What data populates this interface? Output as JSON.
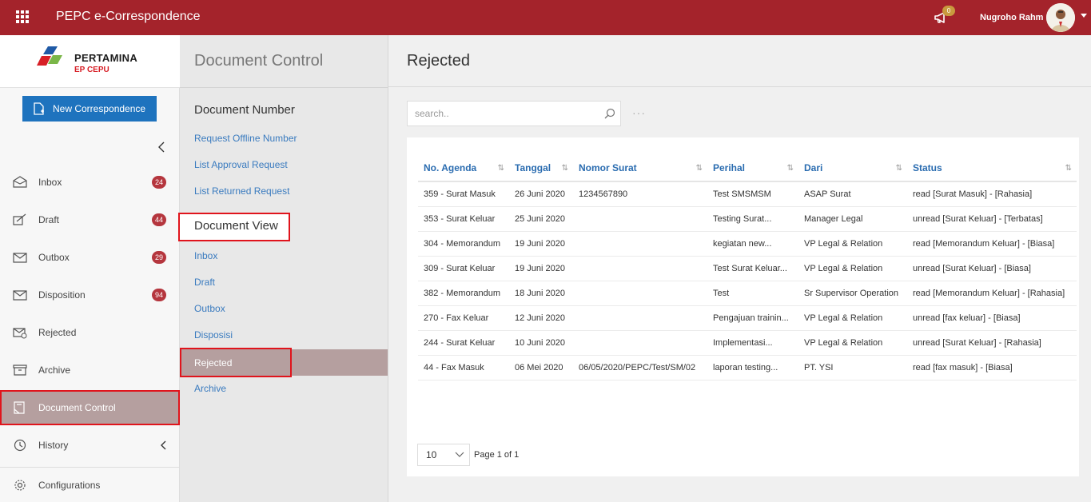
{
  "app": {
    "title": "PEPC e-Correspondence",
    "notification_count": "0",
    "user_name": "Nugroho Rahm"
  },
  "logo": {
    "line1": "PERTAMINA",
    "line2": "EP CEPU"
  },
  "sidebar": {
    "new_button": "New Correspondence",
    "items": [
      {
        "label": "Inbox",
        "badge": "24",
        "icon": "inbox-icon"
      },
      {
        "label": "Draft",
        "badge": "44",
        "icon": "draft-icon"
      },
      {
        "label": "Outbox",
        "badge": "29",
        "icon": "outbox-icon"
      },
      {
        "label": "Disposition",
        "badge": "94",
        "icon": "disposition-icon"
      },
      {
        "label": "Rejected",
        "badge": "",
        "icon": "rejected-icon"
      },
      {
        "label": "Archive",
        "badge": "",
        "icon": "archive-icon"
      },
      {
        "label": "Document Control",
        "badge": "",
        "icon": "document-control-icon"
      },
      {
        "label": "History",
        "badge": "",
        "icon": "history-icon"
      }
    ],
    "configurations": "Configurations"
  },
  "midpanel": {
    "title": "Document Control",
    "section1": "Document Number",
    "section1_links": [
      "Request Offline Number",
      "List Approval Request",
      "List Returned Request"
    ],
    "section2": "Document View",
    "section2_links": [
      "Inbox",
      "Draft",
      "Outbox",
      "Disposisi",
      "Rejected",
      "Archive"
    ]
  },
  "main": {
    "title": "Rejected",
    "search_placeholder": "search..",
    "more": "···",
    "columns": [
      "No. Agenda",
      "Tanggal",
      "Nomor Surat",
      "Perihal",
      "Dari",
      "Status"
    ],
    "rows": [
      [
        "359 - Surat Masuk",
        "26 Juni 2020",
        "1234567890",
        "Test SMSMSM",
        "ASAP Surat",
        "read [Surat Masuk] - [Rahasia]"
      ],
      [
        "353 - Surat Keluar",
        "25 Juni 2020",
        "",
        "Testing Surat...",
        "Manager Legal",
        "unread [Surat Keluar] - [Terbatas]"
      ],
      [
        "304 - Memorandum",
        "19 Juni 2020",
        "",
        "kegiatan new...",
        "VP Legal & Relation",
        "read [Memorandum Keluar] - [Biasa]"
      ],
      [
        "309 - Surat Keluar",
        "19 Juni 2020",
        "",
        "Test Surat Keluar...",
        "VP Legal & Relation",
        "unread [Surat Keluar] - [Biasa]"
      ],
      [
        "382 - Memorandum",
        "18 Juni 2020",
        "",
        "Test",
        "Sr Supervisor Operation",
        "read [Memorandum Keluar] - [Rahasia]"
      ],
      [
        "270 - Fax Keluar",
        "12 Juni 2020",
        "",
        "Pengajuan trainin...",
        "VP Legal & Relation",
        "unread [fax keluar] - [Biasa]"
      ],
      [
        "244 - Surat Keluar",
        "10 Juni 2020",
        "",
        "Implementasi...",
        "VP Legal & Relation",
        "unread [Surat Keluar] - [Rahasia]"
      ],
      [
        "44 - Fax Masuk",
        "06 Mei 2020",
        "06/05/2020/PEPC/Test/SM/02",
        "laporan testing...",
        "PT. YSI",
        "read [fax masuk] - [Biasa]"
      ]
    ],
    "page_size": "10",
    "page_info": "Page 1 of 1"
  },
  "colors": {
    "topbar": "#a4232b",
    "primary_button": "#1e73be",
    "link": "#3a7bbf",
    "active_item": "#b59f9f",
    "badge": "#b5363e",
    "highlight_box": "#e0141c"
  }
}
